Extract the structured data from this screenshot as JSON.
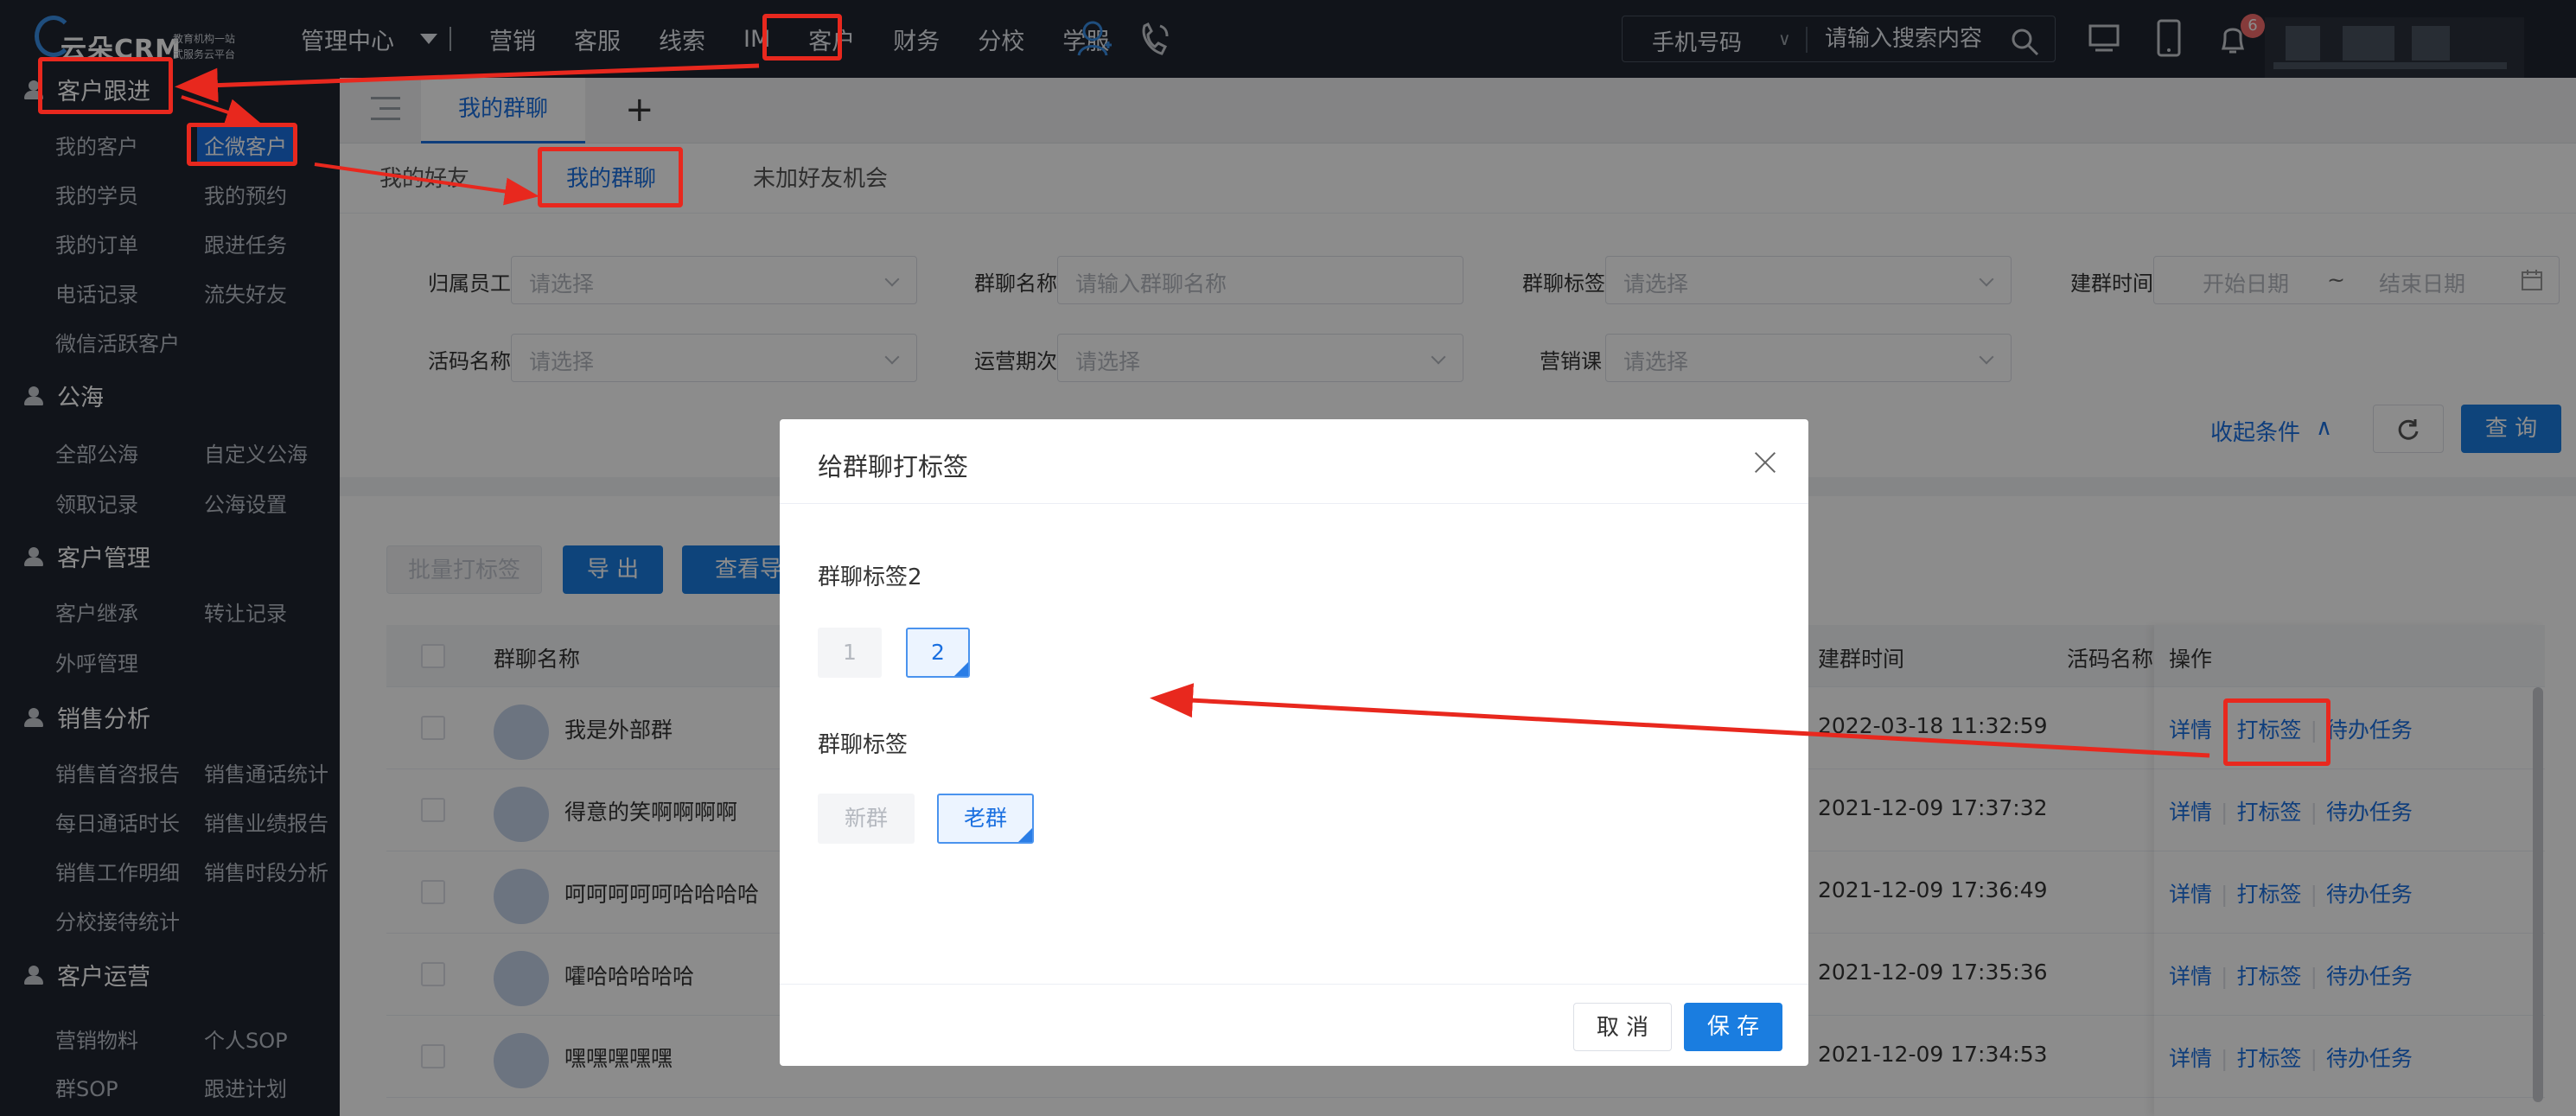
{
  "topbar": {
    "brand": "云朵CRM",
    "tagline1": "教育机构一站",
    "tagline2": "式服务云平台",
    "nav": [
      "管理中心",
      "营销",
      "客服",
      "线索",
      "IM",
      "客户",
      "财务",
      "分校",
      "学服"
    ],
    "search_type": "手机号码",
    "search_placeholder": "请输入搜索内容",
    "notification_count": "6"
  },
  "sidebar": {
    "sections": [
      {
        "title": "客户跟进",
        "items": [
          "我的客户",
          "企微客户",
          "我的学员",
          "我的预约",
          "我的订单",
          "跟进任务",
          "电话记录",
          "流失好友",
          "微信活跃客户"
        ]
      },
      {
        "title": "公海",
        "items": [
          "全部公海",
          "自定义公海",
          "领取记录",
          "公海设置"
        ]
      },
      {
        "title": "客户管理",
        "items": [
          "客户继承",
          "转让记录",
          "外呼管理"
        ]
      },
      {
        "title": "销售分析",
        "items": [
          "销售首咨报告",
          "销售通话统计",
          "每日通话时长",
          "销售业绩报告",
          "销售工作明细",
          "销售时段分析",
          "分校接待统计"
        ]
      },
      {
        "title": "客户运营",
        "items": [
          "营销物料",
          "个人SOP",
          "群SOP",
          "跟进计划"
        ]
      }
    ]
  },
  "tabs": {
    "main_tab": "我的群聊",
    "add": "+"
  },
  "subtabs": [
    "我的好友",
    "我的群聊",
    "未加好友机会"
  ],
  "filters": {
    "owner_label": "归属员工",
    "owner_placeholder": "请选择",
    "group_name_label": "群聊名称",
    "group_name_placeholder": "请输入群聊名称",
    "group_tag_label": "群聊标签",
    "group_tag_placeholder": "请选择",
    "create_time_label": "建群时间",
    "start_placeholder": "开始日期",
    "range_sep": "~",
    "end_placeholder": "结束日期",
    "live_code_label": "活码名称",
    "live_code_placeholder": "请选择",
    "period_label": "运营期次",
    "period_placeholder": "请选择",
    "course_label": "营销课",
    "course_placeholder": "请选择",
    "collapse": "收起条件",
    "query": "查 询"
  },
  "actions": {
    "batch_tag": "批量打标签",
    "export": "导 出",
    "view_export": "查看导出"
  },
  "table": {
    "headers": {
      "name": "群聊名称",
      "create_time": "建群时间",
      "live_code": "活码名称",
      "ops": "操作"
    },
    "rows": [
      {
        "name": "我是外部群",
        "time": "2022-03-18 11:32:59"
      },
      {
        "name": "得意的笑啊啊啊啊",
        "time": "2021-12-09 17:37:32"
      },
      {
        "name": "呵呵呵呵呵哈哈哈哈",
        "time": "2021-12-09 17:36:49"
      },
      {
        "name": "嚯哈哈哈哈哈",
        "time": "2021-12-09 17:35:36"
      },
      {
        "name": "嘿嘿嘿嘿嘿",
        "time": "2021-12-09 17:34:53"
      }
    ],
    "op_labels": {
      "detail": "详情",
      "tag": "打标签",
      "todo": "待办任务"
    }
  },
  "modal": {
    "title": "给群聊打标签",
    "groups": [
      {
        "label": "群聊标签2",
        "tags": [
          {
            "text": "1",
            "selected": false
          },
          {
            "text": "2",
            "selected": true
          }
        ]
      },
      {
        "label": "群聊标签",
        "tags": [
          {
            "text": "新群",
            "selected": false
          },
          {
            "text": "老群",
            "selected": true
          }
        ]
      }
    ],
    "cancel": "取 消",
    "save": "保 存"
  },
  "colors": {
    "accent": "#1a7de0",
    "annotation": "#e8281e",
    "sidebar": "#1f2530"
  }
}
